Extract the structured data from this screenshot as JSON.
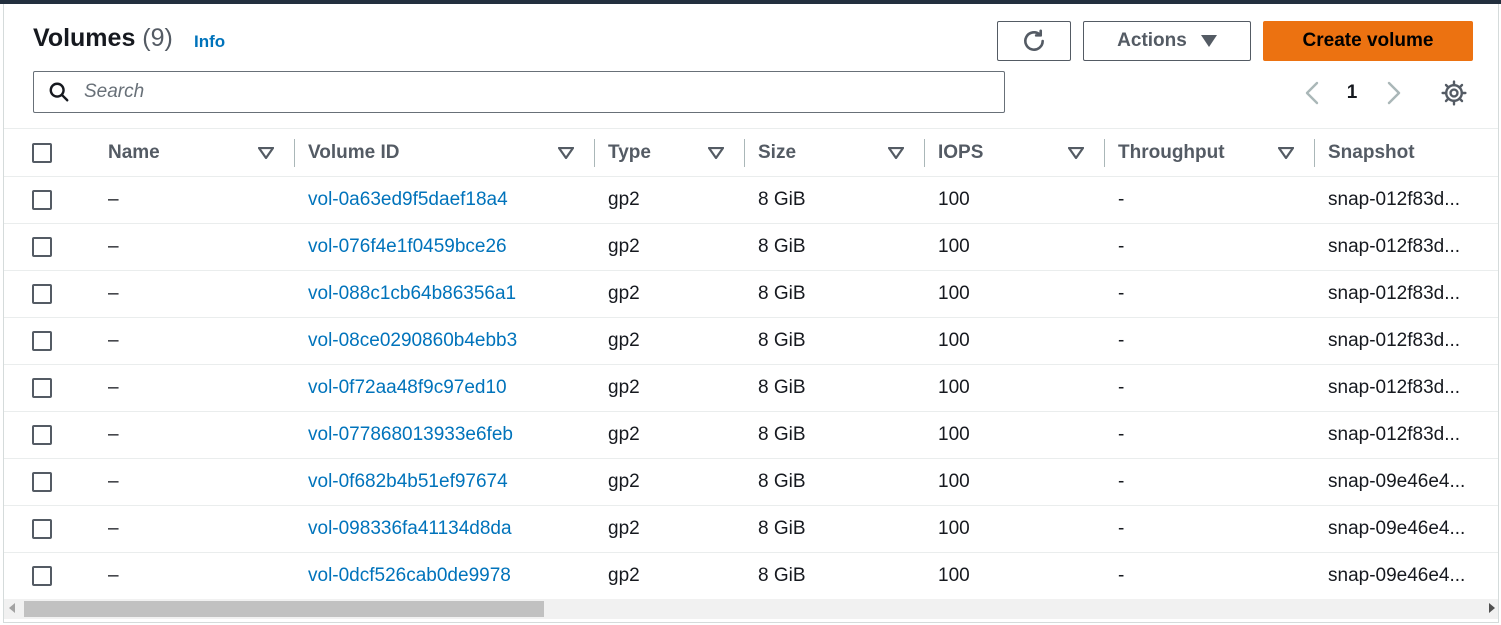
{
  "header": {
    "title": "Volumes",
    "count": "(9)",
    "info_label": "Info"
  },
  "toolbar": {
    "refresh_icon": "refresh-icon",
    "actions_label": "Actions",
    "create_label": "Create volume"
  },
  "search": {
    "placeholder": "Search",
    "value": ""
  },
  "pagination": {
    "current_page": "1"
  },
  "colors": {
    "accent": "#ec7211",
    "link": "#0073bb",
    "topbar": "#232f3e"
  },
  "table": {
    "columns": [
      "Name",
      "Volume ID",
      "Type",
      "Size",
      "IOPS",
      "Throughput",
      "Snapshot"
    ],
    "rows": [
      {
        "name": "–",
        "volume_id": "vol-0a63ed9f5daef18a4",
        "type": "gp2",
        "size": "8 GiB",
        "iops": "100",
        "throughput": "-",
        "snapshot": "snap-012f83d..."
      },
      {
        "name": "–",
        "volume_id": "vol-076f4e1f0459bce26",
        "type": "gp2",
        "size": "8 GiB",
        "iops": "100",
        "throughput": "-",
        "snapshot": "snap-012f83d..."
      },
      {
        "name": "–",
        "volume_id": "vol-088c1cb64b86356a1",
        "type": "gp2",
        "size": "8 GiB",
        "iops": "100",
        "throughput": "-",
        "snapshot": "snap-012f83d..."
      },
      {
        "name": "–",
        "volume_id": "vol-08ce0290860b4ebb3",
        "type": "gp2",
        "size": "8 GiB",
        "iops": "100",
        "throughput": "-",
        "snapshot": "snap-012f83d..."
      },
      {
        "name": "–",
        "volume_id": "vol-0f72aa48f9c97ed10",
        "type": "gp2",
        "size": "8 GiB",
        "iops": "100",
        "throughput": "-",
        "snapshot": "snap-012f83d..."
      },
      {
        "name": "–",
        "volume_id": "vol-077868013933e6feb",
        "type": "gp2",
        "size": "8 GiB",
        "iops": "100",
        "throughput": "-",
        "snapshot": "snap-012f83d..."
      },
      {
        "name": "–",
        "volume_id": "vol-0f682b4b51ef97674",
        "type": "gp2",
        "size": "8 GiB",
        "iops": "100",
        "throughput": "-",
        "snapshot": "snap-09e46e4..."
      },
      {
        "name": "–",
        "volume_id": "vol-098336fa41134d8da",
        "type": "gp2",
        "size": "8 GiB",
        "iops": "100",
        "throughput": "-",
        "snapshot": "snap-09e46e4..."
      },
      {
        "name": "–",
        "volume_id": "vol-0dcf526cab0de9978",
        "type": "gp2",
        "size": "8 GiB",
        "iops": "100",
        "throughput": "-",
        "snapshot": "snap-09e46e4..."
      }
    ]
  }
}
